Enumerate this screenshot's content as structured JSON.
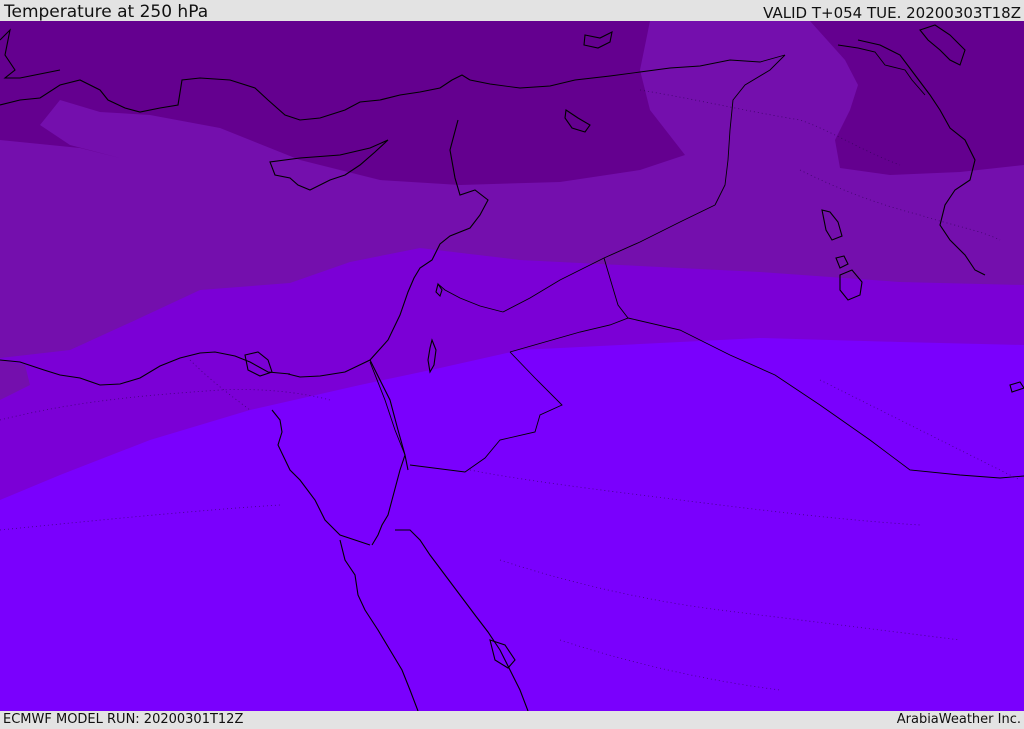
{
  "header": {
    "title": "Temperature at 250 hPa",
    "valid": "VALID T+054 TUE. 20200303T18Z"
  },
  "footer": {
    "model_run": "ECMWF MODEL RUN: 20200301T12Z",
    "credit": "ArabiaWeather Inc."
  },
  "colors": {
    "band_coldest": "#64008f",
    "band_cold": "#740fad",
    "band_mid": "#7b00d6",
    "band_warm": "#7a00fd",
    "coastline": "#000000"
  }
}
